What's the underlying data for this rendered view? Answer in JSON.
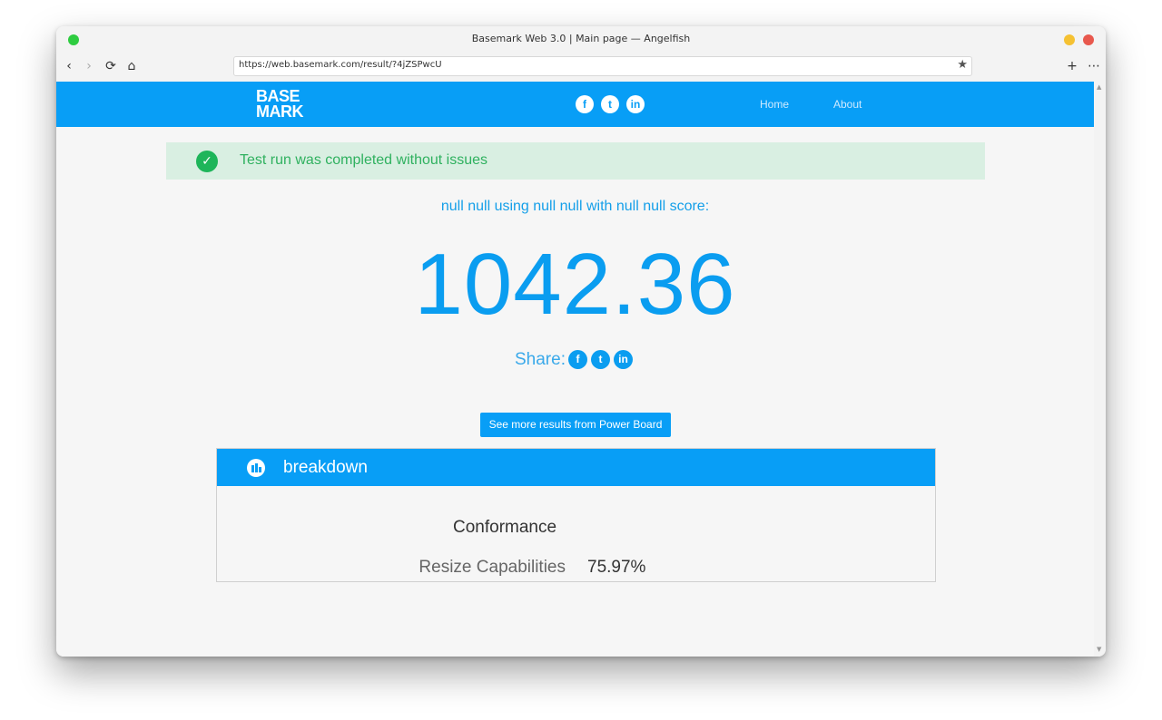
{
  "window": {
    "title": "Basemark Web 3.0 | Main page — Angelfish"
  },
  "toolbar": {
    "back_icon": "‹",
    "forward_icon": "›",
    "reload_icon": "⟳",
    "home_icon": "⌂",
    "url": "https://web.basemark.com/result/?4jZSPwcU",
    "bookmark_icon": "★",
    "new_tab_icon": "+",
    "menu_icon": "⋯"
  },
  "site": {
    "logo_line1": "BASE",
    "logo_line2": "MARK",
    "social": {
      "facebook": "f",
      "twitter": "t",
      "linkedin": "in"
    },
    "nav": {
      "home": "Home",
      "about": "About"
    }
  },
  "alert": {
    "icon": "✓",
    "text": "Test run was completed without issues"
  },
  "result": {
    "caption": "null null using null null with null null score:",
    "score": "1042.36",
    "share_label": "Share:",
    "more_button": "See more results from Power Board"
  },
  "breakdown": {
    "title": "breakdown",
    "section": "Conformance",
    "rows": [
      {
        "label": "Resize Capabilities",
        "value": "75.97%"
      }
    ]
  },
  "colors": {
    "brand_blue": "#089ef6",
    "success_green": "#2fb15f",
    "success_bg": "#d9efe2"
  }
}
